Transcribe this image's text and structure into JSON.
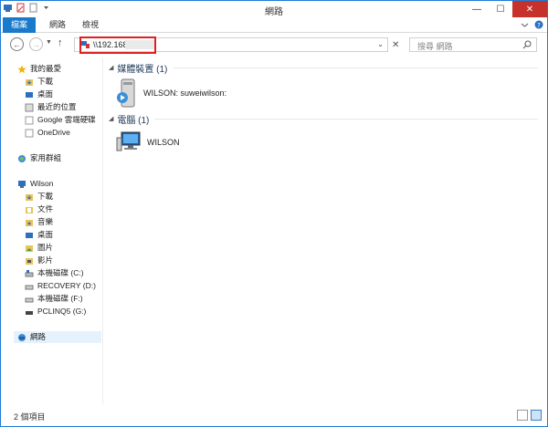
{
  "window": {
    "title": "網路"
  },
  "title_controls": {
    "minimize": "—",
    "maximize": "☐",
    "close": "✕"
  },
  "ribbon": {
    "tabs": [
      "檔案",
      "網路",
      "檢視"
    ],
    "expand_icon": "chevron-down-icon",
    "help_icon": "help-icon"
  },
  "nav": {
    "back": "←",
    "forward": "→",
    "recent": "▼",
    "up": "↑",
    "address": "\\\\192.168.",
    "address_drop": "⌄",
    "clear": "✕",
    "search_placeholder": "搜尋 網路"
  },
  "sidebar": {
    "items": [
      {
        "label": "我的最愛",
        "icon": "star-icon"
      },
      {
        "label": "下載",
        "icon": "download-folder-icon"
      },
      {
        "label": "桌面",
        "icon": "desktop-icon"
      },
      {
        "label": "最近的位置",
        "icon": "recent-places-icon"
      },
      {
        "label": "Google 雲端硬碟",
        "icon": "google-drive-icon"
      },
      {
        "label": "OneDrive",
        "icon": "onedrive-icon"
      },
      {
        "label": "家用群組",
        "icon": "homegroup-icon"
      },
      {
        "label": "Wilson",
        "icon": "computer-icon"
      },
      {
        "label": "下載",
        "icon": "download-folder-icon"
      },
      {
        "label": "文件",
        "icon": "documents-folder-icon"
      },
      {
        "label": "音樂",
        "icon": "music-folder-icon"
      },
      {
        "label": "桌面",
        "icon": "desktop-icon"
      },
      {
        "label": "圖片",
        "icon": "pictures-folder-icon"
      },
      {
        "label": "影片",
        "icon": "videos-folder-icon"
      },
      {
        "label": "本機磁碟 (C:)",
        "icon": "drive-c-icon"
      },
      {
        "label": "RECOVERY (D:)",
        "icon": "drive-icon"
      },
      {
        "label": "本機磁碟 (F:)",
        "icon": "drive-icon"
      },
      {
        "label": "PCLINQ5 (G:)",
        "icon": "drive-usb-icon"
      },
      {
        "label": "網路",
        "icon": "network-icon"
      }
    ]
  },
  "main": {
    "groups": [
      {
        "title": "媒體裝置 (1)",
        "items": [
          {
            "label": "WILSON: suweiwilson:",
            "icon": "media-server-icon"
          }
        ]
      },
      {
        "title": "電腦 (1)",
        "items": [
          {
            "label": "WILSON",
            "icon": "computer-monitor-icon"
          }
        ]
      }
    ]
  },
  "status": {
    "count": "2 個項目"
  },
  "colors": {
    "accent": "#1979ca",
    "highlight_border": "#e02020",
    "close_red": "#c7312b"
  }
}
